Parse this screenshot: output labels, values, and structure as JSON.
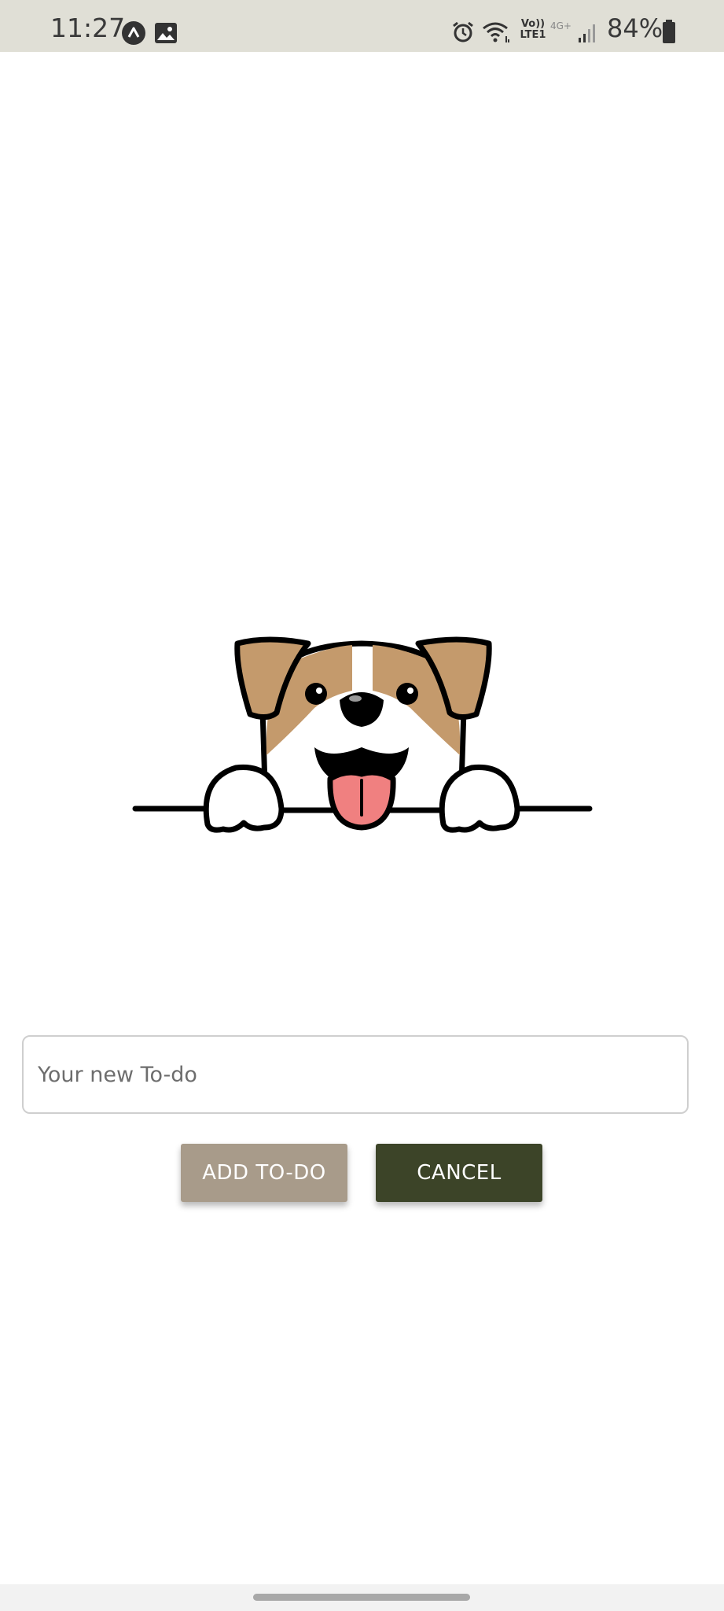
{
  "status_bar": {
    "time": "11:27",
    "battery_percent": "84%",
    "icons": [
      "app-a-icon",
      "gallery-icon",
      "alarm-icon",
      "wifi-icon",
      "volte-icon",
      "network-4g-icon",
      "signal-icon",
      "battery-icon"
    ],
    "volte_label_top": "Vo))",
    "volte_label_bottom": "LTE1",
    "network_label": "4G+"
  },
  "hero": {
    "image": "dog-peeking-illustration",
    "colors": {
      "fur": "#c49a6c",
      "tongue": "#f08080",
      "outline": "#000000"
    }
  },
  "form": {
    "input": {
      "placeholder": "Your new To-do",
      "value": ""
    },
    "add_button_label": "ADD TO-DO",
    "cancel_button_label": "CANCEL"
  },
  "colors": {
    "status_bar_bg": "#e0dfd6",
    "add_button_bg": "#a89b8a",
    "cancel_button_bg": "#3c4428"
  }
}
